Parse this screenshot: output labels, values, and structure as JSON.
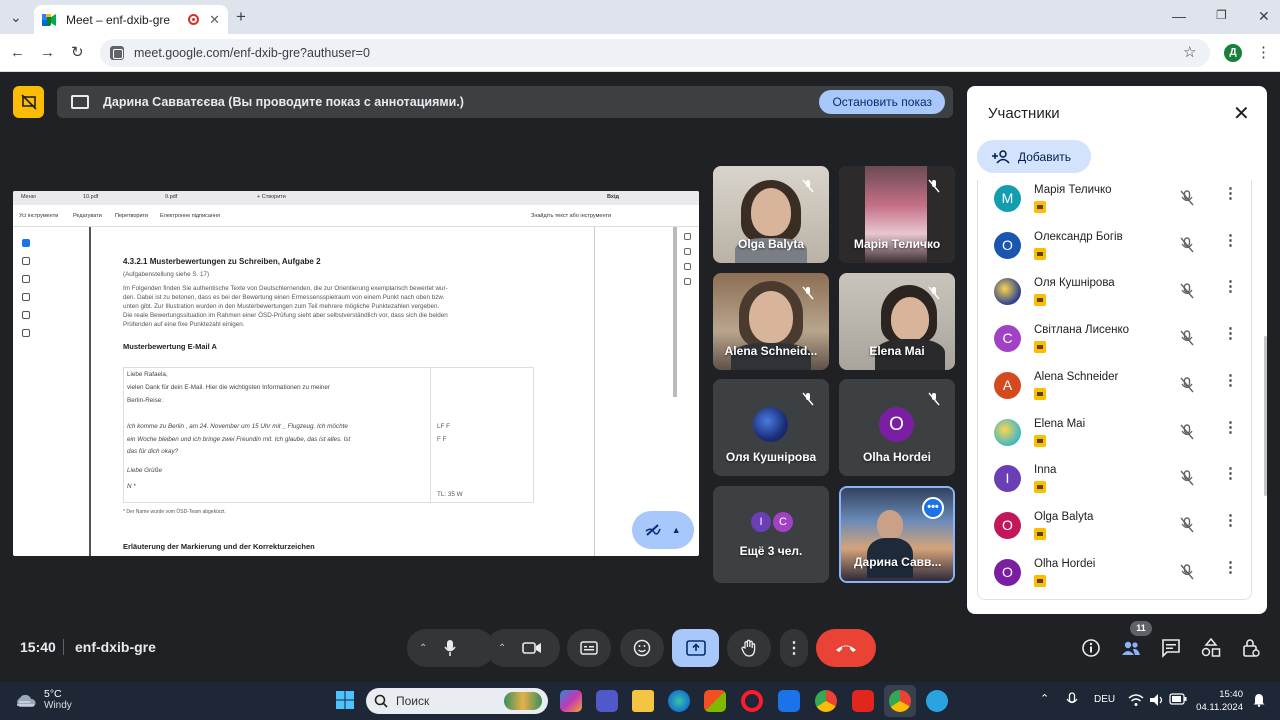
{
  "browser": {
    "tab_title": "Meet – enf-dxib-gre",
    "url": "meet.google.com/enf-dxib-gre?authuser=0",
    "profile_initial": "Д",
    "new_tab": "+"
  },
  "banner": {
    "text": "Дарина Савватєєва (Вы проводите показ с аннотациями.)",
    "stop_label": "Остановить показ"
  },
  "shared_screen": {
    "tabs": [
      "Меню",
      "10.pdf",
      "9.pdf",
      "+ Створити",
      "Вхід"
    ],
    "menu": [
      "Усі інструменти",
      "Редагувати",
      "Перетворити",
      "Електронне підписання",
      "Знайдіть текст або інструменти"
    ],
    "section_title": "4.3.2.1 Musterbewertungen zu Schreiben, Aufgabe 2",
    "section_sub": "(Aufgabenstellung siehe S. 17)",
    "intro_lines": [
      "Im Folgenden finden Sie authentische Texte von Deutschlernenden, die zur Orientierung exemplarisch bewertet wur-",
      "den. Dabei ist zu betonen, dass es bei der Bewertung einen Ermessensspielraum von einem Punkt nach oben bzw.",
      "unten gibt. Zur Illustration wurden in den Musterbewertungen zum Teil mehrere mögliche Punktezahlen vergeben.",
      "Die reale Bewertungssituation im Rahmen einer ÖSD-Prüfung sieht aber selbstverständlich vor, dass sich die beiden",
      "Prüfenden auf eine fixe Punktezahl einigen."
    ],
    "sample_title": "Musterbewertung E-Mail A",
    "letter_lines": [
      "Liebe Rafaela,",
      "vielen Dank für dein E-Mail. Hier die wichtigsten Informationen zu meiner",
      "Berlin-Reise:",
      "",
      "Ich komme zu Berlin , am 24. November um 15 Uhr mit _ Flugzeug. Ich möchte",
      "ein Woche bleiben und ich bringe zwei Freundin mit. Ich glaube, das ist alles. Ist",
      "das für dich okay?",
      "",
      "Liebe Grüße",
      "N *"
    ],
    "margin_note_1": "LF F",
    "margin_note_2": "F F",
    "score": "TL: 35 W",
    "footnote": "* Der Name wurde vom ÖSD-Team abgekürzt.",
    "bottom_heading": "Erläuterung der Markierung und der Korrekturzeichen"
  },
  "tiles": [
    {
      "name": "Olga Balyta",
      "type": "video"
    },
    {
      "name": "Марія Теличко",
      "type": "video"
    },
    {
      "name": "Alena Schneid...",
      "type": "video"
    },
    {
      "name": "Elena Mai",
      "type": "video"
    },
    {
      "name": "Оля Кушнірова",
      "type": "avatar"
    },
    {
      "name": "Olha Hordei",
      "type": "avatar",
      "initial": "O",
      "color": "#7b1fa2"
    },
    {
      "name": "Ещё 3 чел.",
      "type": "more",
      "initials": [
        "I",
        "C"
      ]
    },
    {
      "name": "Дарина Савв...",
      "type": "self"
    }
  ],
  "participants": {
    "title": "Участники",
    "add_label": "Добавить",
    "list": [
      {
        "name": "Марія Теличко",
        "initial": "M",
        "color": "#129eaf"
      },
      {
        "name": "Олександр Богів",
        "initial": "О",
        "color": "#1a56b0"
      },
      {
        "name": "Оля Кушнірова",
        "initial": "",
        "color": "#2a3f8f"
      },
      {
        "name": "Світлана Лисенко",
        "initial": "С",
        "color": "#a142c4"
      },
      {
        "name": "Alena Schneider",
        "initial": "A",
        "color": "#d44a1e"
      },
      {
        "name": "Elena Mai",
        "initial": "",
        "color": "#3fb7c9"
      },
      {
        "name": "Inna",
        "initial": "I",
        "color": "#6a3fb5"
      },
      {
        "name": "Olga Balyta",
        "initial": "O",
        "color": "#c2185b"
      },
      {
        "name": "Olha Hordei",
        "initial": "O",
        "color": "#7b1fa2"
      }
    ]
  },
  "controls": {
    "time": "15:40",
    "meeting_code": "enf-dxib-gre",
    "people_count": "11"
  },
  "taskbar": {
    "temperature": "5°C",
    "weather": "Windy",
    "search_placeholder": "Поиск",
    "language": "DEU",
    "clock_time": "15:40",
    "clock_date": "04.11.2024"
  },
  "colors": {
    "accent": "#a8c7fa",
    "end_call": "#ea4335",
    "meet_bg": "#202124",
    "presenting_badge": "#fbbc04"
  }
}
